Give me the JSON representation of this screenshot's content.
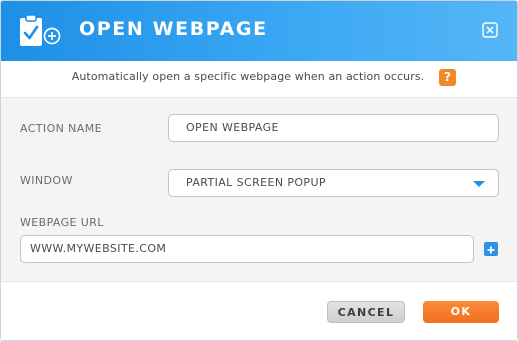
{
  "dialog": {
    "title": "OPEN WEBPAGE",
    "description": "Automatically open a specific webpage when an action occurs.",
    "help_icon_text": "?",
    "icons": {
      "header": "clipboard-check-plus-icon",
      "close": "close-icon",
      "help": "help-icon",
      "dropdown": "chevron-down-icon",
      "add": "plus-icon"
    }
  },
  "form": {
    "action_name": {
      "label": "ACTION NAME",
      "value": "OPEN WEBPAGE"
    },
    "window": {
      "label": "WINDOW",
      "selected": "PARTIAL SCREEN POPUP"
    },
    "webpage_url": {
      "label": "WEBPAGE URL",
      "value": "WWW.MYWEBSITE.COM"
    }
  },
  "footer": {
    "cancel_label": "CANCEL",
    "ok_label": "OK"
  },
  "colors": {
    "header_start": "#1d8fe6",
    "header_end": "#55b6f6",
    "accent_blue": "#1f8fe3",
    "help_orange": "#f0892a",
    "ok_orange": "#f37a26",
    "cancel_gray": "#d8d8d8"
  }
}
